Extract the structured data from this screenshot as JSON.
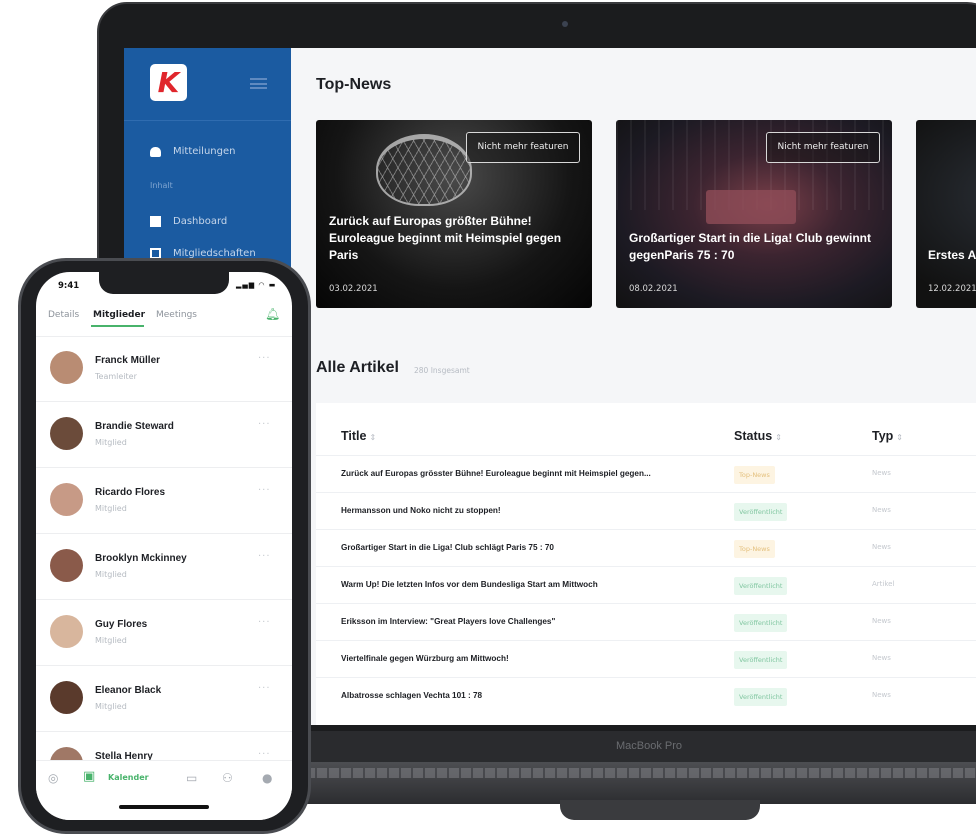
{
  "laptop": {
    "model_label": "MacBook Pro",
    "sidebar": {
      "logo_letter": "K",
      "items": [
        {
          "label": "Mitteilungen",
          "icon": "bell-icon"
        },
        {
          "label": "Dashboard",
          "icon": "dashboard-icon"
        },
        {
          "label": "Mitgliedschaften",
          "icon": "members-icon"
        }
      ],
      "section_label": "Inhalt"
    },
    "top_news": {
      "heading": "Top-News",
      "cards": [
        {
          "feature_label": "Nicht mehr featuren",
          "title": "Zurück auf Europas größter Bühne! Euroleague beginnt mit Heimspiel gegen Paris",
          "date": "03.02.2021"
        },
        {
          "feature_label": "Nicht mehr featuren",
          "title": "Großartiger Start in die Liga! Club gewinnt gegenParis 75 : 70",
          "date": "08.02.2021"
        },
        {
          "feature_label": "",
          "title": "Erstes A",
          "date": "12.02.2021"
        }
      ]
    },
    "articles": {
      "heading": "Alle Artikel",
      "count_label": "280 Insgesamt",
      "columns": {
        "title": "Title",
        "status": "Status",
        "typ": "Typ",
        "sort_icon": "⇕"
      },
      "rows": [
        {
          "title": "Zurück auf Europas grösster Bühne! Euroleague beginnt mit Heimspiel gegen...",
          "status": "Top-News",
          "status_color": "yellow",
          "typ": "News"
        },
        {
          "title": "Hermansson und Noko nicht zu stoppen!",
          "status": "Veröffentlicht",
          "status_color": "green",
          "typ": "News"
        },
        {
          "title": "Großartiger Start in die Liga! Club schlägt Paris 75 : 70",
          "status": "Top-News",
          "status_color": "yellow",
          "typ": "News"
        },
        {
          "title": "Warm Up! Die letzten Infos vor dem Bundesliga Start am Mittwoch",
          "status": "Veröffentlicht",
          "status_color": "green",
          "typ": "Artikel"
        },
        {
          "title": "Eriksson im Interview: \"Great Players love Challenges\"",
          "status": "Veröffentlicht",
          "status_color": "green",
          "typ": "News"
        },
        {
          "title": "Viertelfinale gegen Würzburg am Mittwoch!",
          "status": "Veröffentlicht",
          "status_color": "green",
          "typ": "News"
        },
        {
          "title": "Albatrosse schlagen Vechta 101 : 78",
          "status": "Veröffentlicht",
          "status_color": "green",
          "typ": "News"
        }
      ]
    },
    "colors": {
      "sidebar": "#1b5ba1",
      "logo_red": "#e0262c",
      "badge_green_bg": "#e7f7ee",
      "badge_yellow_bg": "#fdf4e2"
    }
  },
  "phone": {
    "time": "9:41",
    "status_icons": "▂▄▆ ◠ ▬",
    "tabs": [
      {
        "label": "Details",
        "active": false
      },
      {
        "label": "Mitglieder",
        "active": true
      },
      {
        "label": "Meetings",
        "active": false
      }
    ],
    "bell_icon": "bell-icon",
    "members": [
      {
        "name": "Franck Müller",
        "role": "Teamleiter"
      },
      {
        "name": "Brandie Steward",
        "role": "Mitglied"
      },
      {
        "name": "Ricardo Flores",
        "role": "Mitglied"
      },
      {
        "name": "Brooklyn Mckinney",
        "role": "Mitglied"
      },
      {
        "name": "Guy Flores",
        "role": "Mitglied"
      },
      {
        "name": "Eleanor Black",
        "role": "Mitglied"
      },
      {
        "name": "Stella Henry",
        "role": ""
      }
    ],
    "more_glyph": "···",
    "bottom_nav": {
      "active_label": "Kalender"
    },
    "accent_color": "#48b36b"
  }
}
